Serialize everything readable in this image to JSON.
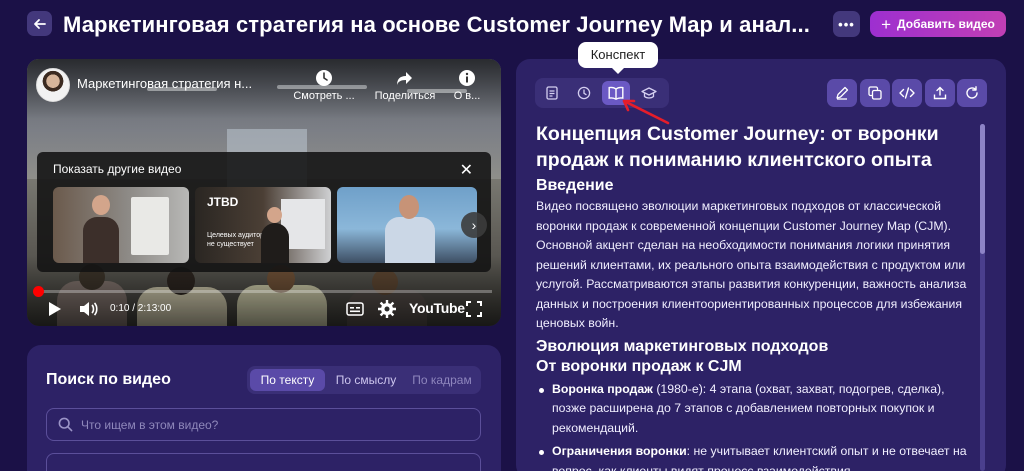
{
  "header": {
    "title": "Маркетинговая стратегия на основе Customer Journey Map и анал...",
    "add_video_label": "Добавить видео",
    "more_label": "•••"
  },
  "player": {
    "video_title": "Маркетинговая стратегия н...",
    "actions": [
      {
        "icon": "clock-icon",
        "label": "Смотреть ..."
      },
      {
        "icon": "share-icon",
        "label": "Поделиться"
      },
      {
        "icon": "info-icon",
        "label": "О в..."
      }
    ],
    "more_videos_title": "Показать другие видео",
    "thumbnails": [
      {
        "big": "",
        "small": ""
      },
      {
        "big": "JTBD",
        "small": "Целевых аудиторий не существует"
      },
      {
        "big": "",
        "small": ""
      }
    ],
    "time": "0:10 / 2:13:00",
    "progress": 0.0013,
    "youtube_label": "YouTube"
  },
  "search": {
    "title": "Поиск по видео",
    "modes": [
      {
        "label": "По тексту",
        "active": true
      },
      {
        "label": "По смыслу",
        "active": false
      },
      {
        "label": "По кадрам",
        "active": false
      }
    ],
    "placeholder": "Что ищем в этом видео?"
  },
  "summary_panel": {
    "tabs": [
      {
        "icon": "document-icon"
      },
      {
        "icon": "clock-icon"
      },
      {
        "icon": "book-icon",
        "active": true
      },
      {
        "icon": "graduation-cap-icon"
      }
    ],
    "tooltip": "Конспект",
    "tools": [
      "pencil-icon",
      "copy-icon",
      "code-icon",
      "export-icon",
      "refresh-icon"
    ],
    "content": {
      "title": "Концепция Customer Journey: от воронки продаж к пониманию клиентского опыта",
      "intro_heading": "Введение",
      "intro_text": "Видео посвящено эволюции маркетинговых подходов от классической воронки продаж к современной концепции Customer Journey Map (CJM). Основной акцент сделан на необходимости понимания логики принятия решений клиентами, их реального опыта взаимодействия с продуктом или услугой. Рассматриваются этапы развития конкуренции, важность анализа данных и построения клиентоориентированных процессов для избежания ценовых войн.",
      "evolution_heading": "Эволюция маркетинговых подходов",
      "funnel_heading": "От воронки продаж к CJM",
      "bullets": [
        {
          "bold": "Воронка продаж",
          "text": " (1980-е): 4 этапа (охват, захват, подогрев, сделка), позже расширена до 7 этапов с добавлением повторных покупок и рекомендаций."
        },
        {
          "bold": "Ограничения воронки",
          "text": ": не учитывает клиентский опыт и не отвечает на вопрос, как клиенты видят процесс взаимодействия."
        }
      ]
    }
  },
  "colors": {
    "background": "#1b1147",
    "card": "#2d2266",
    "accent": "#c13fb4",
    "active_tab": "#6b59c4"
  }
}
